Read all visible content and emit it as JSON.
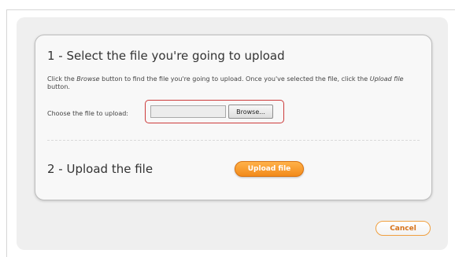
{
  "step1": {
    "title": "1 - Select the file you're going to upload",
    "instructions": {
      "part1": "Click the ",
      "browse_word": "Browse",
      "part2": " button to find the file you're going to upload. Once you've selected the file, click the ",
      "upload_word": "Upload file",
      "part3": " button."
    },
    "choose_label": "Choose the file to upload:",
    "file_input": {
      "value": ""
    },
    "browse_label": "Browse...",
    "highlight_color": "#cc3b3b"
  },
  "step2": {
    "title": "2 - Upload the file",
    "upload_button_label": "Upload file",
    "accent_color": "#f28a1a"
  },
  "footer": {
    "cancel_label": "Cancel"
  }
}
